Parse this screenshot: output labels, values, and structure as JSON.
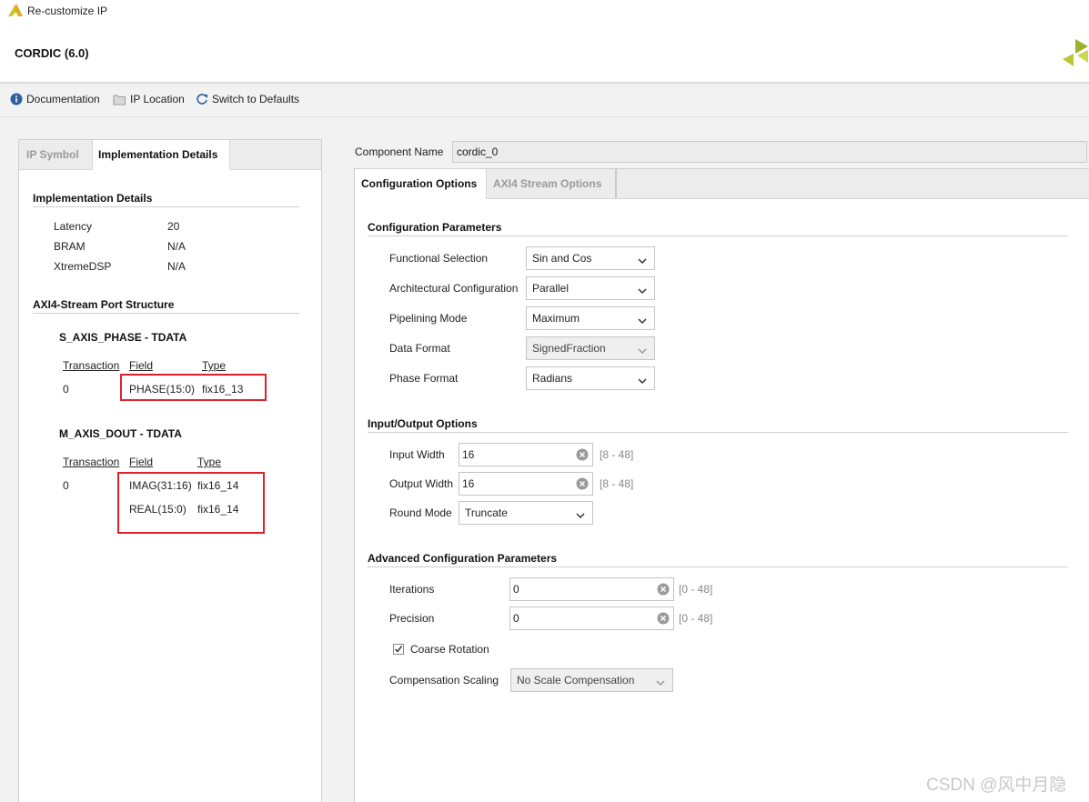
{
  "window": {
    "title": "Re-customize IP"
  },
  "header": {
    "ip_name": "CORDIC (6.0)"
  },
  "toolbar": {
    "documentation": "Documentation",
    "ip_location": "IP Location",
    "switch_defaults": "Switch to Defaults"
  },
  "left": {
    "tabs": [
      "IP Symbol",
      "Implementation Details"
    ],
    "impl_title": "Implementation Details",
    "impl": [
      {
        "key": "Latency",
        "value": "20"
      },
      {
        "key": "BRAM",
        "value": "N/A"
      },
      {
        "key": "XtremeDSP",
        "value": "N/A"
      }
    ],
    "port_title": "AXI4-Stream Port Structure",
    "s_axis": {
      "title": "S_AXIS_PHASE - TDATA",
      "headers": [
        "Transaction",
        "Field",
        "Type"
      ],
      "rows": [
        {
          "transaction": "0",
          "field": "PHASE(15:0)",
          "type": "fix16_13"
        }
      ]
    },
    "m_axis": {
      "title": "M_AXIS_DOUT - TDATA",
      "headers": [
        "Transaction",
        "Field",
        "Type"
      ],
      "rows": [
        {
          "transaction": "0",
          "field": "IMAG(31:16)",
          "type": "fix16_14"
        },
        {
          "transaction": "",
          "field": "REAL(15:0)",
          "type": "fix16_14"
        }
      ]
    }
  },
  "component": {
    "label": "Component Name",
    "value": "cordic_0"
  },
  "right": {
    "tabs": [
      "Configuration Options",
      "AXI4 Stream Options"
    ],
    "config_params": {
      "title": "Configuration Parameters",
      "rows": [
        {
          "label": "Functional Selection",
          "value": "Sin and Cos"
        },
        {
          "label": "Architectural Configuration",
          "value": "Parallel"
        },
        {
          "label": "Pipelining Mode",
          "value": "Maximum"
        },
        {
          "label": "Data Format",
          "value": "SignedFraction"
        },
        {
          "label": "Phase Format",
          "value": "Radians"
        }
      ]
    },
    "io": {
      "title": "Input/Output Options",
      "input_width": {
        "label": "Input Width",
        "value": "16",
        "range": "[8 - 48]"
      },
      "output_width": {
        "label": "Output Width",
        "value": "16",
        "range": "[8 - 48]"
      },
      "round_mode": {
        "label": "Round Mode",
        "value": "Truncate"
      }
    },
    "advanced": {
      "title": "Advanced Configuration Parameters",
      "iterations": {
        "label": "Iterations",
        "value": "0",
        "range": "[0 - 48]"
      },
      "precision": {
        "label": "Precision",
        "value": "0",
        "range": "[0 - 48]"
      },
      "coarse_rotation": {
        "label": "Coarse Rotation",
        "checked": true
      },
      "compensation": {
        "label": "Compensation Scaling",
        "value": "No Scale Compensation"
      }
    }
  },
  "watermark": "CSDN @风中月隐",
  "colors": {
    "highlight_box": "#e0202a",
    "brand_green": "#a9c23f"
  }
}
